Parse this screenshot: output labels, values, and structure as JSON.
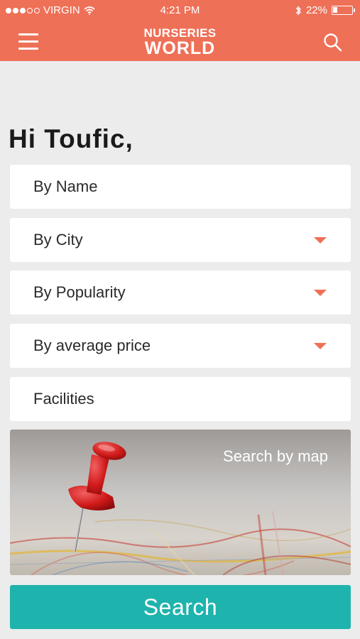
{
  "status_bar": {
    "carrier": "VIRGIN",
    "time": "4:21 PM",
    "battery": "22%",
    "battery_level": 0.22,
    "signal_bars": 3
  },
  "header": {
    "logo_top": "NURSERIES",
    "logo_bottom": "WORLD",
    "icons": {
      "menu": "hamburger-menu-icon",
      "search": "search-icon"
    },
    "background_color": "#ee7057"
  },
  "greeting": "Hi Toufic,",
  "filters": [
    {
      "label": "By Name",
      "dropdown": false
    },
    {
      "label": "By City",
      "dropdown": true
    },
    {
      "label": "By Popularity",
      "dropdown": true
    },
    {
      "label": "By average price",
      "dropdown": true
    },
    {
      "label": "Facilities",
      "dropdown": false
    }
  ],
  "map": {
    "label": "Search by map"
  },
  "search_button": {
    "label": "Search",
    "color": "#1fb3ad"
  }
}
